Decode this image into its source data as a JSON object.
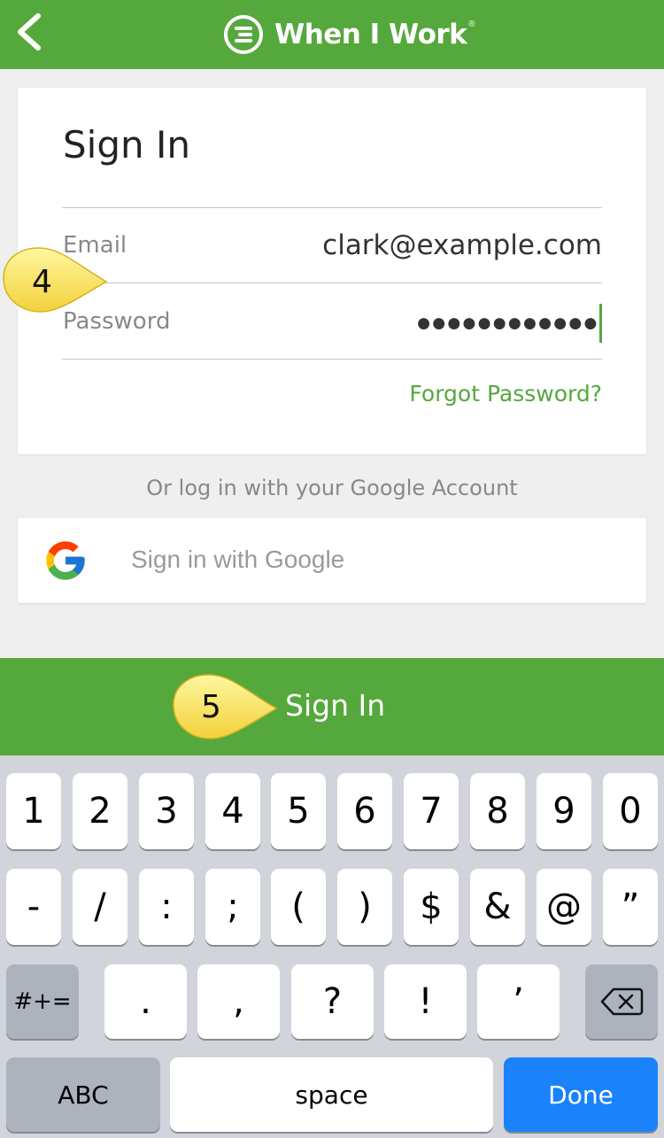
{
  "header": {
    "brand": "When I Work",
    "brand_mark": "®",
    "color": "#55a83c"
  },
  "card": {
    "title": "Sign In",
    "email_label": "Email",
    "email_value": "clark@example.com",
    "password_label": "Password",
    "password_value": "●●●●●●●●●●●●",
    "forgot_link": "Forgot Password?"
  },
  "google": {
    "or_text": "Or log in with your Google  Account",
    "button_label": "Sign in with Google"
  },
  "primary_button": {
    "label": "Sign In"
  },
  "callouts": [
    {
      "number": "4"
    },
    {
      "number": "5"
    }
  ],
  "keyboard": {
    "row1": [
      "1",
      "2",
      "3",
      "4",
      "5",
      "6",
      "7",
      "8",
      "9",
      "0"
    ],
    "row2": [
      "-",
      "/",
      ":",
      ";",
      "(",
      ")",
      "$",
      "&",
      "@",
      "”"
    ],
    "row3_symbols_key": "#+=",
    "row3": [
      ".",
      ",",
      "?",
      "!",
      "’"
    ],
    "abc_key": "ABC",
    "space_key": "space",
    "done_key": "Done"
  }
}
